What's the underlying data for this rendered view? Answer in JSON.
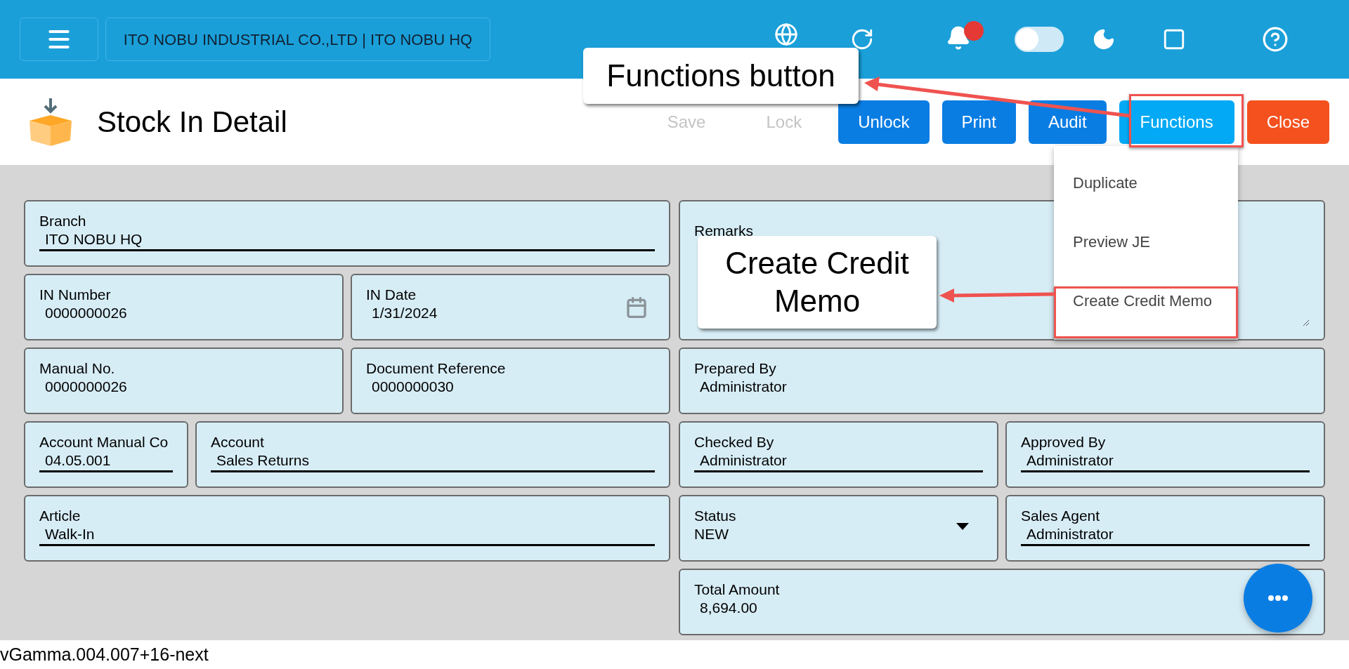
{
  "top_bar": {
    "company": "ITO NOBU INDUSTRIAL CO.,LTD | ITO NOBU HQ",
    "notification_badge": true,
    "dark_mode": {
      "on": false
    }
  },
  "page": {
    "title": "Stock In Detail"
  },
  "toolbar": [
    {
      "label": "Save",
      "disabled": true
    },
    {
      "label": "Lock",
      "disabled": true
    },
    {
      "label": "Unlock",
      "kind": "primary",
      "disabled": false
    },
    {
      "label": "Print",
      "kind": "primary",
      "disabled": false
    },
    {
      "label": "Audit",
      "kind": "primary",
      "disabled": false
    },
    {
      "label": "Functions",
      "kind": "accent",
      "disabled": false
    },
    {
      "label": "Close",
      "kind": "danger",
      "disabled": false
    }
  ],
  "functions_menu": {
    "expanded": true,
    "items": [
      {
        "label": "Duplicate"
      },
      {
        "label": "Preview JE"
      },
      {
        "label": "Create Credit Memo"
      }
    ]
  },
  "form_left": [
    [
      {
        "label": "Branch",
        "value": "ITO NOBU HQ",
        "kind": "underlined"
      }
    ],
    [
      {
        "label": "IN Number",
        "value": "0000000026",
        "kind": "plain"
      },
      {
        "label": "IN Date",
        "value": "1/31/2024",
        "kind": "date"
      }
    ],
    [
      {
        "label": "Manual No.",
        "value": "0000000026",
        "kind": "plain"
      },
      {
        "label": "Document Reference",
        "value": "0000000030",
        "kind": "plain"
      }
    ],
    [
      {
        "label": "Account Manual Co",
        "value": "04.05.001",
        "kind": "underlined"
      },
      {
        "label": "Account",
        "value": "Sales Returns",
        "kind": "underlined"
      }
    ],
    [
      {
        "label": "Article",
        "value": "Walk-In",
        "kind": "underlined"
      }
    ]
  ],
  "remarks": {
    "label": "Remarks"
  },
  "form_right": [
    [
      {
        "label": "Prepared By",
        "value": "Administrator",
        "kind": "plain"
      }
    ],
    [
      {
        "label": "Checked By",
        "value": "Administrator",
        "kind": "underlined"
      },
      {
        "label": "Approved By",
        "value": "Administrator",
        "kind": "underlined"
      }
    ],
    [
      {
        "label": "Status",
        "value": "NEW",
        "kind": "select"
      },
      {
        "label": "Sales Agent",
        "value": "Administrator",
        "kind": "underlined"
      }
    ],
    [
      {
        "label": "Total Amount",
        "value": "8,694.00",
        "kind": "plain"
      }
    ]
  ],
  "annotations": [
    {
      "text": "Functions button"
    },
    {
      "text": "Create Credit Memo"
    }
  ],
  "version": "vGamma.004.007+16-next"
}
